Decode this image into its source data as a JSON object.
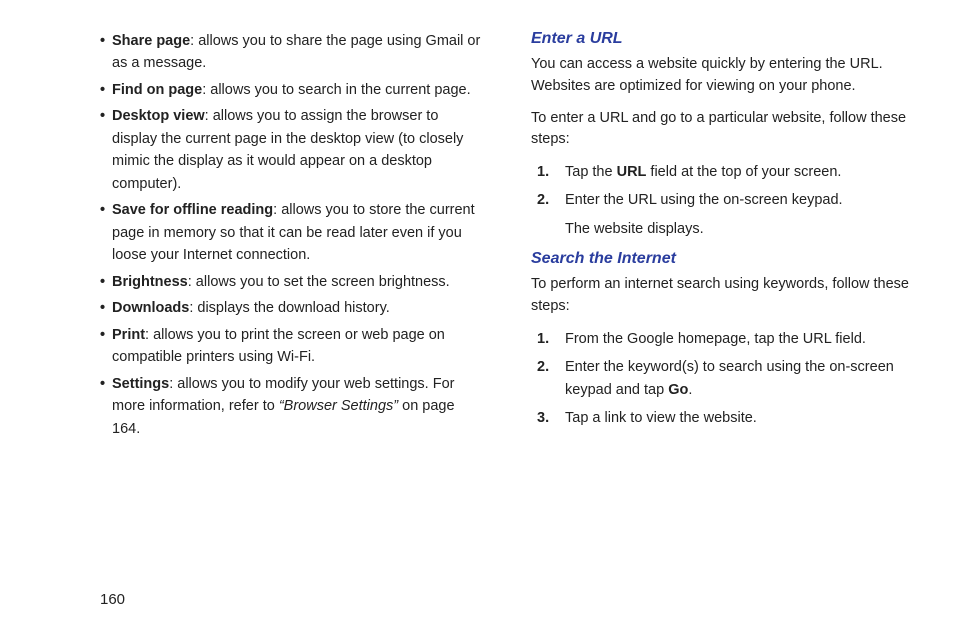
{
  "pageNumber": "160",
  "leftColumn": {
    "bullets": [
      {
        "title": "Share page",
        "desc": ": allows you to share the page using Gmail or as a message."
      },
      {
        "title": "Find on page",
        "desc": ": allows you to search in the current page."
      },
      {
        "title": "Desktop view",
        "desc": ": allows you to assign the browser to display the current page in the desktop view (to closely mimic the display as it would appear on a desktop computer)."
      },
      {
        "title": "Save for offline reading",
        "desc": ": allows you to store the current page in memory so that it can be read later even if you loose your Internet connection."
      },
      {
        "title": "Brightness",
        "desc": ": allows you to set the screen brightness."
      },
      {
        "title": "Downloads",
        "desc": ": displays the download history."
      },
      {
        "title": "Print",
        "desc": ": allows you to print the screen or web page on compatible printers using Wi-Fi."
      },
      {
        "title": "Settings",
        "desc": ": allows you to modify your web settings. For more information, refer to ",
        "refText": "“Browser Settings” ",
        "refTail": " on page 164."
      }
    ]
  },
  "rightColumn": {
    "sections": [
      {
        "heading": "Enter a URL",
        "paragraphs": [
          "You can access a website quickly by entering the URL. Websites are optimized for viewing on your phone.",
          "To enter a URL and go to a particular website, follow these steps:"
        ],
        "steps": [
          {
            "num": "1.",
            "pre": "Tap the ",
            "bold": "URL",
            "post": " field at the top of your screen."
          },
          {
            "num": "2.",
            "pre": "Enter the URL using the on-screen keypad.",
            "bold": "",
            "post": "",
            "sub": "The website displays."
          }
        ]
      },
      {
        "heading": "Search the Internet",
        "paragraphs": [
          "To perform an internet search using keywords, follow these steps:"
        ],
        "steps": [
          {
            "num": "1.",
            "pre": "From the Google homepage, tap the URL field.",
            "bold": "",
            "post": ""
          },
          {
            "num": "2.",
            "pre": "Enter the keyword(s) to search using the on-screen keypad and tap ",
            "bold": "Go",
            "post": "."
          },
          {
            "num": "3.",
            "pre": "Tap a link to view the website.",
            "bold": "",
            "post": ""
          }
        ]
      }
    ]
  }
}
